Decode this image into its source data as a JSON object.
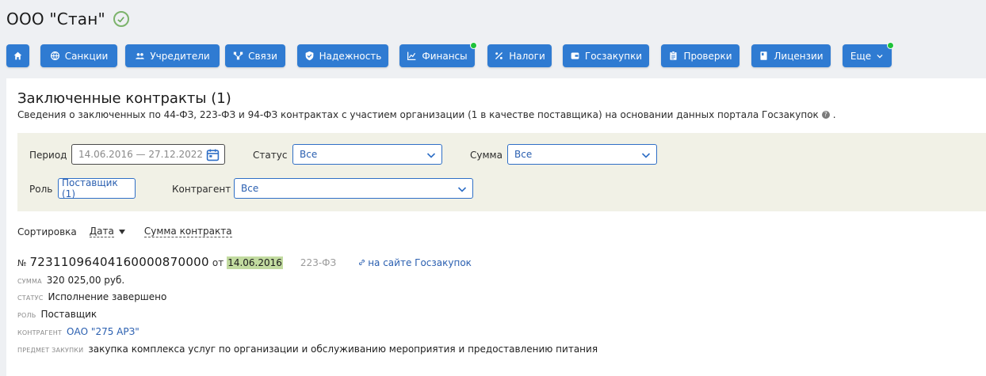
{
  "company": {
    "name": "ООО \"Стан\""
  },
  "nav": {
    "items": [
      {
        "label": "",
        "icon": "home-icon"
      },
      {
        "label": "Санкции",
        "icon": "globe-icon"
      },
      {
        "label": "Учредители",
        "icon": "users-icon"
      },
      {
        "label": "Связи",
        "icon": "network-icon"
      },
      {
        "label": "Надежность",
        "icon": "shield-icon"
      },
      {
        "label": "Финансы",
        "icon": "chart-icon",
        "has_dot": true
      },
      {
        "label": "Налоги",
        "icon": "percent-icon"
      },
      {
        "label": "Госзакупки",
        "icon": "wallet-icon"
      },
      {
        "label": "Проверки",
        "icon": "clipboard-icon"
      },
      {
        "label": "Лицензии",
        "icon": "document-icon"
      },
      {
        "label": "Еще",
        "icon": "chevron-down-icon",
        "has_dot": true
      }
    ],
    "accent": "#2f7bd2",
    "dot_color": "#1fc23a"
  },
  "section": {
    "title": "Заключенные контракты (1)",
    "subtitle": "Сведения о заключенных по 44-ФЗ, 223-ФЗ и 94-ФЗ контрактах с участием организации (1 в качестве поставщика) на основании данных портала Госзакупок",
    "subtitle_end": ".",
    "help_icon": "?"
  },
  "filters": {
    "period_label": "Период",
    "period_value": "14.06.2016 — 27.12.2022",
    "status_label": "Статус",
    "status_value": "Все",
    "sum_label": "Сумма",
    "sum_value": "Все",
    "role_label": "Роль",
    "role_value": "Поставщик (1)",
    "counterparty_label": "Контрагент",
    "counterparty_value": "Все"
  },
  "sort": {
    "label": "Сортировка",
    "by_date": "Дата",
    "by_sum": "Сумма контракта"
  },
  "contract": {
    "no_prefix": "№",
    "number": "72311096404160000870000",
    "ot": "от",
    "date": "14.06.2016",
    "law": "223-ФЗ",
    "link_text": "на сайте Госзакупок",
    "sum_label": "сумма",
    "sum_value": "320 025,00 руб.",
    "status_label": "статус",
    "status_value": "Исполнение завершено",
    "role_label": "роль",
    "role_value": "Поставщик",
    "counterparty_label": "контрагент",
    "counterparty_value": "ОАО \"275 АРЗ\"",
    "subject_label": "предмет закупки",
    "subject_value": "закупка комплекса услуг по организации и обслуживанию мероприятия и предоставлению питания"
  }
}
